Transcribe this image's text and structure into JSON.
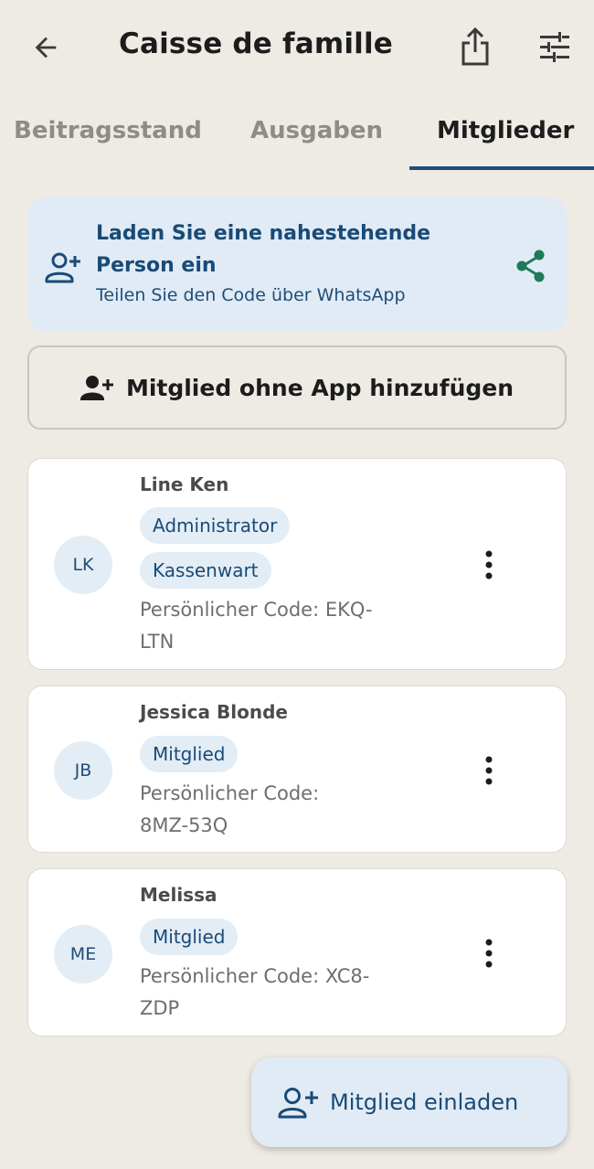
{
  "app_bar": {
    "title": "Caisse de famille",
    "back_icon": "arrow-back-icon",
    "share_icon": "share-export-icon",
    "settings_icon": "tune-sliders-icon"
  },
  "tabs": [
    {
      "label": "Beitragsstand",
      "selected": false
    },
    {
      "label": "Ausgaben",
      "selected": false
    },
    {
      "label": "Mitglieder",
      "selected": true
    }
  ],
  "invite_banner": {
    "title": "Laden Sie eine nahestehende Person ein",
    "subtitle": "Teilen Sie den Code über WhatsApp",
    "icon": "person-add-icon",
    "share_icon": "share-nodes-icon"
  },
  "add_without_app": {
    "label": "Mitglied ohne App hinzufügen",
    "icon": "person-add-filled-icon"
  },
  "members": [
    {
      "initials": "LK",
      "name": "Line Ken",
      "roles": [
        "Administrator",
        "Kassenwart"
      ],
      "code_line1": "Persönlicher Code: EKQ-",
      "code_line2": "LTN"
    },
    {
      "initials": "JB",
      "name": "Jessica Blonde",
      "roles": [
        "Mitglied"
      ],
      "code_line1": "Persönlicher Code:",
      "code_line2": "8MZ-53Q"
    },
    {
      "initials": "ME",
      "name": "Melissa",
      "roles": [
        "Mitglied"
      ],
      "code_line1": "Persönlicher Code: XC8-",
      "code_line2": "ZDP"
    }
  ],
  "fab": {
    "label": "Mitglied einladen",
    "icon": "person-add-icon"
  },
  "colors": {
    "background": "#eeebe5",
    "accent": "#1f4d7a",
    "chip": "#e3edf6",
    "share_green": "#1e7a5a"
  }
}
